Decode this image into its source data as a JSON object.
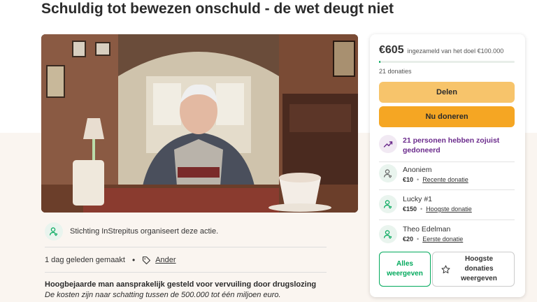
{
  "page": {
    "title": "Schuldig tot bewezen onschuld - de wet deugt niet"
  },
  "organizer": {
    "text": "Stichting InStrepitus organiseert deze actie.",
    "icon": "user-heart-icon"
  },
  "meta": {
    "created": "1 dag geleden gemaakt",
    "separator": "•",
    "category": "Ander",
    "category_icon": "tag-icon"
  },
  "story": {
    "headline": "Hoogbejaarde man aansprakelijk gesteld voor vervuiling door drugslozing",
    "subline": "De kosten zijn naar schatting tussen de 500.000 tot één miljoen euro."
  },
  "donation_panel": {
    "amount": "€605",
    "goal_text": "ingezameld van het doel €100.000",
    "progress_fraction": 0.006,
    "donor_count": "21 donaties",
    "share_label": "Delen",
    "donate_label": "Nu doneren",
    "recent_activity": "21 personen hebben zojuist gedoneerd",
    "donations": [
      {
        "name": "Anoniem",
        "amount": "€10",
        "label": "Recente donatie"
      },
      {
        "name": "Lucky #1",
        "amount": "€150",
        "label": "Hoogste donatie"
      },
      {
        "name": "Theo Edelman",
        "amount": "€20",
        "label": "Eerste donatie"
      }
    ],
    "see_all_label": "Alles weergeven",
    "see_top_label": "Hoogste donaties weergeven",
    "dot": "•"
  },
  "colors": {
    "accent_green": "#02a95c",
    "share_yellow": "#f7c46b",
    "donate_orange": "#f5a623",
    "recent_purple": "#6b2b8c"
  }
}
